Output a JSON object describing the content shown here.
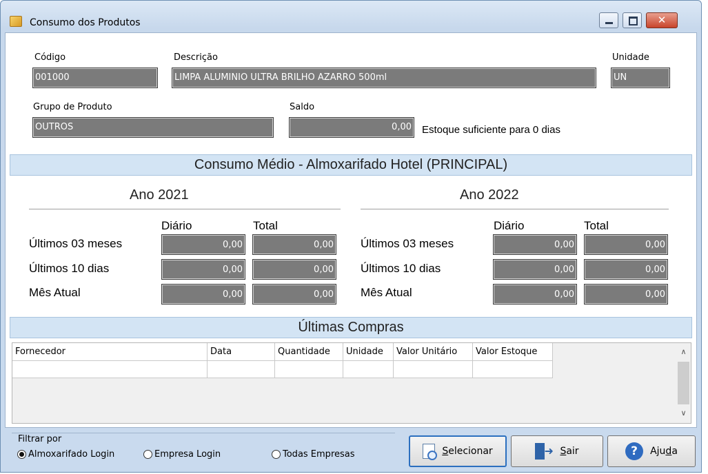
{
  "window": {
    "title": "Consumo dos Produtos",
    "close_glyph": "✕"
  },
  "produto": {
    "codigo_label": "Código",
    "codigo_value": "001000",
    "descricao_label": "Descrição",
    "descricao_value": "LIMPA ALUMINIO ULTRA BRILHO AZARRO 500ml",
    "unidade_label": "Unidade",
    "unidade_value": "UN",
    "grupo_label": "Grupo de Produto",
    "grupo_value": "OUTROS",
    "saldo_label": "Saldo",
    "saldo_value": "0,00",
    "estoque_msg": "Estoque suficiente para 0 dias"
  },
  "consumo": {
    "header": "Consumo Médio - Almoxarifado Hotel (PRINCIPAL)",
    "col_diario": "Diário",
    "col_total": "Total",
    "row_labels": [
      "Últimos 03 meses",
      "Últimos 10 dias",
      "Mês Atual"
    ],
    "years": [
      {
        "title": "Ano 2021",
        "rows": [
          [
            "0,00",
            "0,00"
          ],
          [
            "0,00",
            "0,00"
          ],
          [
            "0,00",
            "0,00"
          ]
        ]
      },
      {
        "title": "Ano 2022",
        "rows": [
          [
            "0,00",
            "0,00"
          ],
          [
            "0,00",
            "0,00"
          ],
          [
            "0,00",
            "0,00"
          ]
        ]
      }
    ]
  },
  "compras": {
    "header": "Últimas Compras",
    "columns": [
      "Fornecedor",
      "Data",
      "Quantidade",
      "Unidade",
      "Valor Unitário",
      "Valor Estoque"
    ],
    "scroll_up": "∧",
    "scroll_down": "∨"
  },
  "filtro": {
    "label": "Filtrar por",
    "options": [
      "Almoxarifado Login",
      "Empresa Login",
      "Todas Empresas"
    ],
    "selected": "Almoxarifado Login"
  },
  "buttons": {
    "selecionar": {
      "first": "S",
      "rest": "elecionar"
    },
    "sair": {
      "first": "S",
      "rest": "air"
    },
    "ajuda": {
      "pre": "Aju",
      "ul": "d",
      "post": "a"
    },
    "help_glyph": "?",
    "exit_glyph": "➜"
  }
}
